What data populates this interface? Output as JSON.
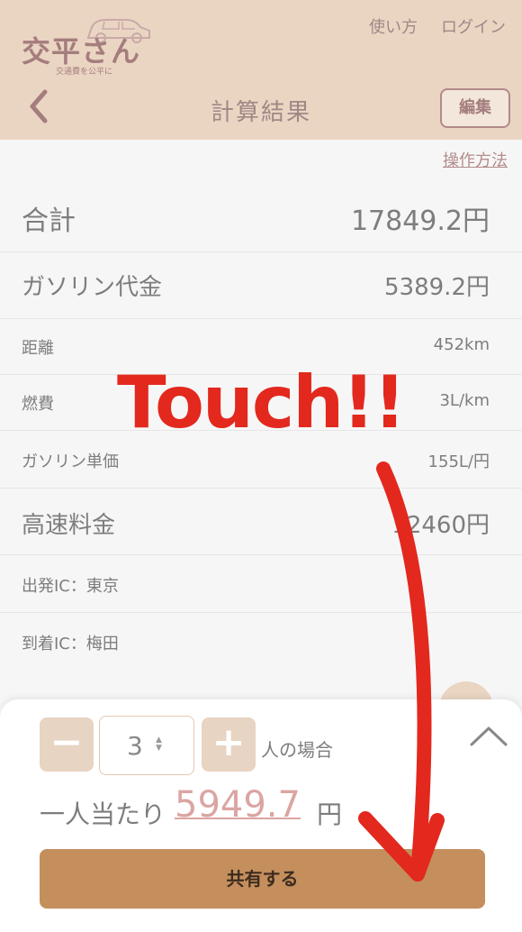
{
  "header": {
    "logo_text": "交平さん",
    "logo_subtitle": "交通費を公平に",
    "how_to_use": "使い方",
    "login": "ログイン",
    "title": "計算結果",
    "edit_label": "編集"
  },
  "operation_link": "操作方法",
  "rows": [
    {
      "label": "合計",
      "value": "17849.2円"
    },
    {
      "label": "ガソリン代金",
      "value": "5389.2円"
    },
    {
      "label": "距離",
      "value": "452km"
    },
    {
      "label": "燃費",
      "value": "3L/km"
    },
    {
      "label": "ガソリン単価",
      "value": "155L/円"
    },
    {
      "label": "高速料金",
      "value": "12460円"
    },
    {
      "label": "出発IC：東京",
      "value": ""
    },
    {
      "label": "到着IC：梅田",
      "value": ""
    }
  ],
  "annotation": {
    "text": "Touch!!"
  },
  "sheet": {
    "minus_label": "−",
    "plus_label": "+",
    "quantity": "3",
    "people_label": "人の場合",
    "per_person_label": "一人当たり",
    "per_person_value": "5949.7",
    "per_person_unit": "円",
    "share_label": "共有する"
  },
  "icons": {
    "back": "back-chevron-icon",
    "collapse": "chevron-up-icon",
    "logo_car": "car-icon"
  },
  "colors": {
    "header_bg": "#ead5c2",
    "share_button": "#c48f5d",
    "accent_value": "#dba5a2",
    "annotation": "#e3281e"
  }
}
